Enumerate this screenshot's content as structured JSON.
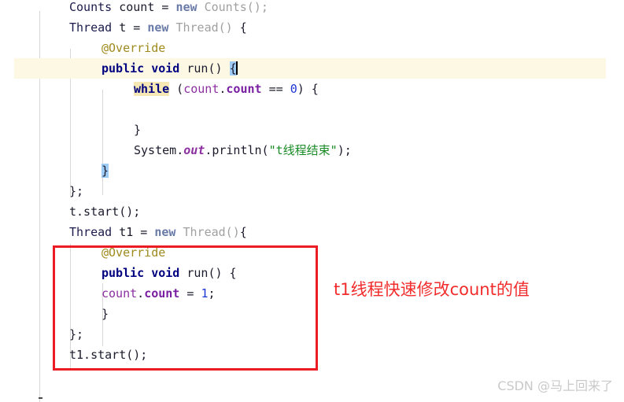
{
  "editor": {
    "language": "java",
    "theme": "IntelliJ Light",
    "colors": {
      "background": "#ffffff",
      "current_line_highlight": "#fdf8e4",
      "search_highlight": "#f5e8b4",
      "brace_match_highlight": "#9fccf5",
      "indent_guide": "#d8d8d8",
      "keyword": "#000080",
      "annotation": "#9e8a1e",
      "field": "#8c2fa0",
      "number": "#1d36d6",
      "string": "#1a8a26",
      "gray_class": "#a0a0a0"
    },
    "lines": [
      {
        "id": "line-counts-decl",
        "indent": 0,
        "clipped_top": true,
        "tokens": [
          {
            "text": "Counts",
            "style": "t-type"
          },
          {
            "text": " count = ",
            "style": "t-plain"
          },
          {
            "text": "new",
            "style": "t-kw-new"
          },
          {
            "text": " Counts();",
            "style": "t-gray"
          }
        ]
      },
      {
        "id": "line-thread-t-decl",
        "indent": 0,
        "tokens": [
          {
            "text": "Thread",
            "style": "t-type"
          },
          {
            "text": " t = ",
            "style": "t-plain"
          },
          {
            "text": "new",
            "style": "t-kw-new"
          },
          {
            "text": " ",
            "style": "t-plain"
          },
          {
            "text": "Thread()",
            "style": "t-gray"
          },
          {
            "text": " {",
            "style": "t-plain"
          }
        ]
      },
      {
        "id": "line-override-1",
        "indent": 1,
        "tokens": [
          {
            "text": "@Override",
            "style": "t-anno"
          }
        ]
      },
      {
        "id": "line-run-1",
        "indent": 1,
        "current_line": true,
        "tokens": [
          {
            "text": "public",
            "style": "t-kw"
          },
          {
            "text": " ",
            "style": "t-plain"
          },
          {
            "text": "void",
            "style": "t-kw"
          },
          {
            "text": " run() ",
            "style": "t-plain"
          },
          {
            "text": "{",
            "style": "t-plain",
            "highlight": "brace"
          },
          {
            "text": "",
            "style": "caret"
          }
        ]
      },
      {
        "id": "line-while",
        "indent": 2,
        "tokens": [
          {
            "text": "while",
            "style": "t-kw",
            "highlight": "search"
          },
          {
            "text": " (",
            "style": "t-plain"
          },
          {
            "text": "count",
            "style": "t-field"
          },
          {
            "text": ".",
            "style": "t-plain"
          },
          {
            "text": "count",
            "style": "t-field-b"
          },
          {
            "text": " == ",
            "style": "t-plain"
          },
          {
            "text": "0",
            "style": "t-num"
          },
          {
            "text": ") {",
            "style": "t-plain"
          }
        ]
      },
      {
        "id": "line-blank-1",
        "indent": 0,
        "tokens": []
      },
      {
        "id": "line-close-while",
        "indent": 2,
        "tokens": [
          {
            "text": "}",
            "style": "t-plain"
          }
        ]
      },
      {
        "id": "line-println",
        "indent": 2,
        "tokens": [
          {
            "text": "System",
            "style": "t-plain"
          },
          {
            "text": ".",
            "style": "t-plain"
          },
          {
            "text": "out",
            "style": "t-static"
          },
          {
            "text": ".println(",
            "style": "t-plain"
          },
          {
            "text": "\"t线程结束\"",
            "style": "t-str"
          },
          {
            "text": ");",
            "style": "t-plain"
          }
        ]
      },
      {
        "id": "line-close-run-1",
        "indent": 1,
        "tokens": [
          {
            "text": "}",
            "style": "t-plain",
            "highlight": "brace"
          }
        ]
      },
      {
        "id": "line-close-anon-1",
        "indent": 0,
        "tokens": [
          {
            "text": "};",
            "style": "t-plain"
          }
        ]
      },
      {
        "id": "line-t-start",
        "indent": 0,
        "tokens": [
          {
            "text": "t.start();",
            "style": "t-plain"
          }
        ]
      },
      {
        "id": "line-thread-t1-decl",
        "indent": 0,
        "tokens": [
          {
            "text": "Thread",
            "style": "t-type"
          },
          {
            "text": " t1 = ",
            "style": "t-plain"
          },
          {
            "text": "new",
            "style": "t-kw-new"
          },
          {
            "text": " ",
            "style": "t-plain"
          },
          {
            "text": "Thread()",
            "style": "t-gray"
          },
          {
            "text": "{",
            "style": "t-plain"
          }
        ]
      },
      {
        "id": "line-override-2",
        "indent": 1,
        "tokens": [
          {
            "text": "@Override",
            "style": "t-anno"
          }
        ]
      },
      {
        "id": "line-run-2",
        "indent": 1,
        "tokens": [
          {
            "text": "public",
            "style": "t-kw"
          },
          {
            "text": " ",
            "style": "t-plain"
          },
          {
            "text": "void",
            "style": "t-kw"
          },
          {
            "text": " run() {",
            "style": "t-plain"
          }
        ]
      },
      {
        "id": "line-count-assign",
        "indent": 1,
        "tokens": [
          {
            "text": "count",
            "style": "t-field"
          },
          {
            "text": ".",
            "style": "t-plain"
          },
          {
            "text": "count",
            "style": "t-field-b"
          },
          {
            "text": " = ",
            "style": "t-plain"
          },
          {
            "text": "1",
            "style": "t-num"
          },
          {
            "text": ";",
            "style": "t-plain"
          }
        ]
      },
      {
        "id": "line-close-run-2",
        "indent": 1,
        "tokens": [
          {
            "text": "}",
            "style": "t-plain"
          }
        ]
      },
      {
        "id": "line-close-anon-2",
        "indent": 0,
        "tokens": [
          {
            "text": "};",
            "style": "t-plain"
          }
        ]
      },
      {
        "id": "line-t1-start",
        "indent": 0,
        "tokens": [
          {
            "text": "t1.start();",
            "style": "t-plain"
          }
        ]
      }
    ]
  },
  "annotations": {
    "red_box": {
      "label": "t1-thread-block-highlight",
      "color": "#ec1c24"
    },
    "note": {
      "text": "t1线程快速修改count的值",
      "color": "#f22c2c"
    }
  },
  "watermark": {
    "text": "CSDN @马上回来了",
    "color": "#c9c9c9"
  }
}
